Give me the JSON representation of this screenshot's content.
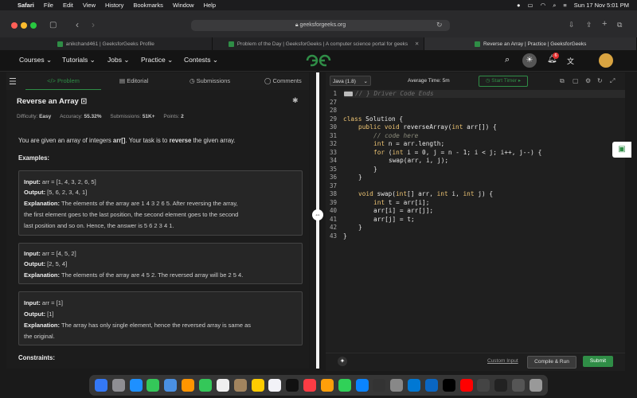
{
  "menubar": {
    "items": [
      "Safari",
      "File",
      "Edit",
      "View",
      "History",
      "Bookmarks",
      "Window",
      "Help"
    ],
    "datetime": "Sun 17 Nov  5:01 PM"
  },
  "browser": {
    "url": "geeksforgeeks.org",
    "tabs": [
      {
        "title": "anikchand461 | GeeksforGeeks Profile"
      },
      {
        "title": "Problem of the Day | GeeksforGeeks | A computer science portal for geeks"
      },
      {
        "title": "Reverse an Array | Practice | GeeksforGeeks"
      }
    ]
  },
  "header": {
    "nav": [
      "Courses",
      "Tutorials",
      "Jobs",
      "Practice",
      "Contests"
    ],
    "notification_count": "6"
  },
  "left_tabs": [
    "Problem",
    "Editorial",
    "Submissions",
    "Comments"
  ],
  "problem": {
    "title": "Reverse an Array",
    "difficulty_label": "Difficulty:",
    "difficulty": "Easy",
    "accuracy_label": "Accuracy:",
    "accuracy": "55.32%",
    "submissions_label": "Submissions:",
    "submissions": "51K+",
    "points_label": "Points:",
    "points": "2",
    "desc_1": "You are given an array of integers ",
    "desc_bold_1": "arr[]",
    "desc_2": ". Your task is to ",
    "desc_bold_2": "reverse",
    "desc_3": " the given array.",
    "examples_heading": "Examples:",
    "input_label": "Input:",
    "output_label": "Output:",
    "explanation_label": "Explanation:",
    "ex1_input": "arr = [1, 4, 3, 2, 6, 5]",
    "ex1_output": "[5, 6, 2, 3, 4, 1]",
    "ex1_expl_1": "The elements of the array are 1 4 3 2 6 5. After reversing the array,",
    "ex1_expl_2": "the first element goes to the last position, the second element goes to the second",
    "ex1_expl_3": "last position and so on. Hence, the answer is 5 6 2 3 4 1.",
    "ex2_input": "arr = [4, 5, 2]",
    "ex2_output": "[2, 5, 4]",
    "ex2_expl": "The elements of the array are 4 5 2. The reversed array will be 2 5 4.",
    "ex3_input": "arr = [1]",
    "ex3_output": "[1]",
    "ex3_expl_1": "The array has only single element, hence the reversed array is same as",
    "ex3_expl_2": "the original.",
    "constraints_heading": "Constraints:"
  },
  "editor": {
    "language": "Java (1.8)",
    "avg_time": "Average Time: 5m",
    "start_timer": "Start Timer",
    "line_numbers": [
      "1",
      "27",
      "28",
      "29",
      "30",
      "31",
      "32",
      "33",
      "34",
      "35",
      "36",
      "37",
      "38",
      "39",
      "40",
      "41",
      "42",
      "43"
    ],
    "code": {
      "l1": "// } Driver Code Ends",
      "l29a": "class",
      "l29b": " Solution {",
      "l30a": "public void",
      "l30b": " reverseArray(",
      "l30c": "int",
      "l30d": " arr[]) {",
      "l31": "// code here",
      "l32a": "int",
      "l32b": " n = arr.length;",
      "l33a": "for",
      "l33b": " (",
      "l33c": "int",
      "l33d": " i = 0, j = n - 1; i < j; i++, j--) {",
      "l34": "swap(arr, i, j);",
      "l35": "}",
      "l36": "}",
      "l38a": "void",
      "l38b": " swap(",
      "l38c": "int",
      "l38d": "[] arr, ",
      "l38e": "int",
      "l38f": " i, ",
      "l38g": "int",
      "l38h": " j) {",
      "l39a": "int",
      "l39b": " t = arr[i];",
      "l40": "arr[i] = arr[j];",
      "l41": "arr[j] = t;",
      "l42": "}",
      "l43": "}"
    },
    "custom_input": "Custom Input",
    "compile_run": "Compile & Run",
    "submit": "Submit"
  },
  "colors": {
    "gfg_green": "#2f8d46",
    "submit_green": "#2f8d46",
    "notif_red": "#e03030"
  }
}
